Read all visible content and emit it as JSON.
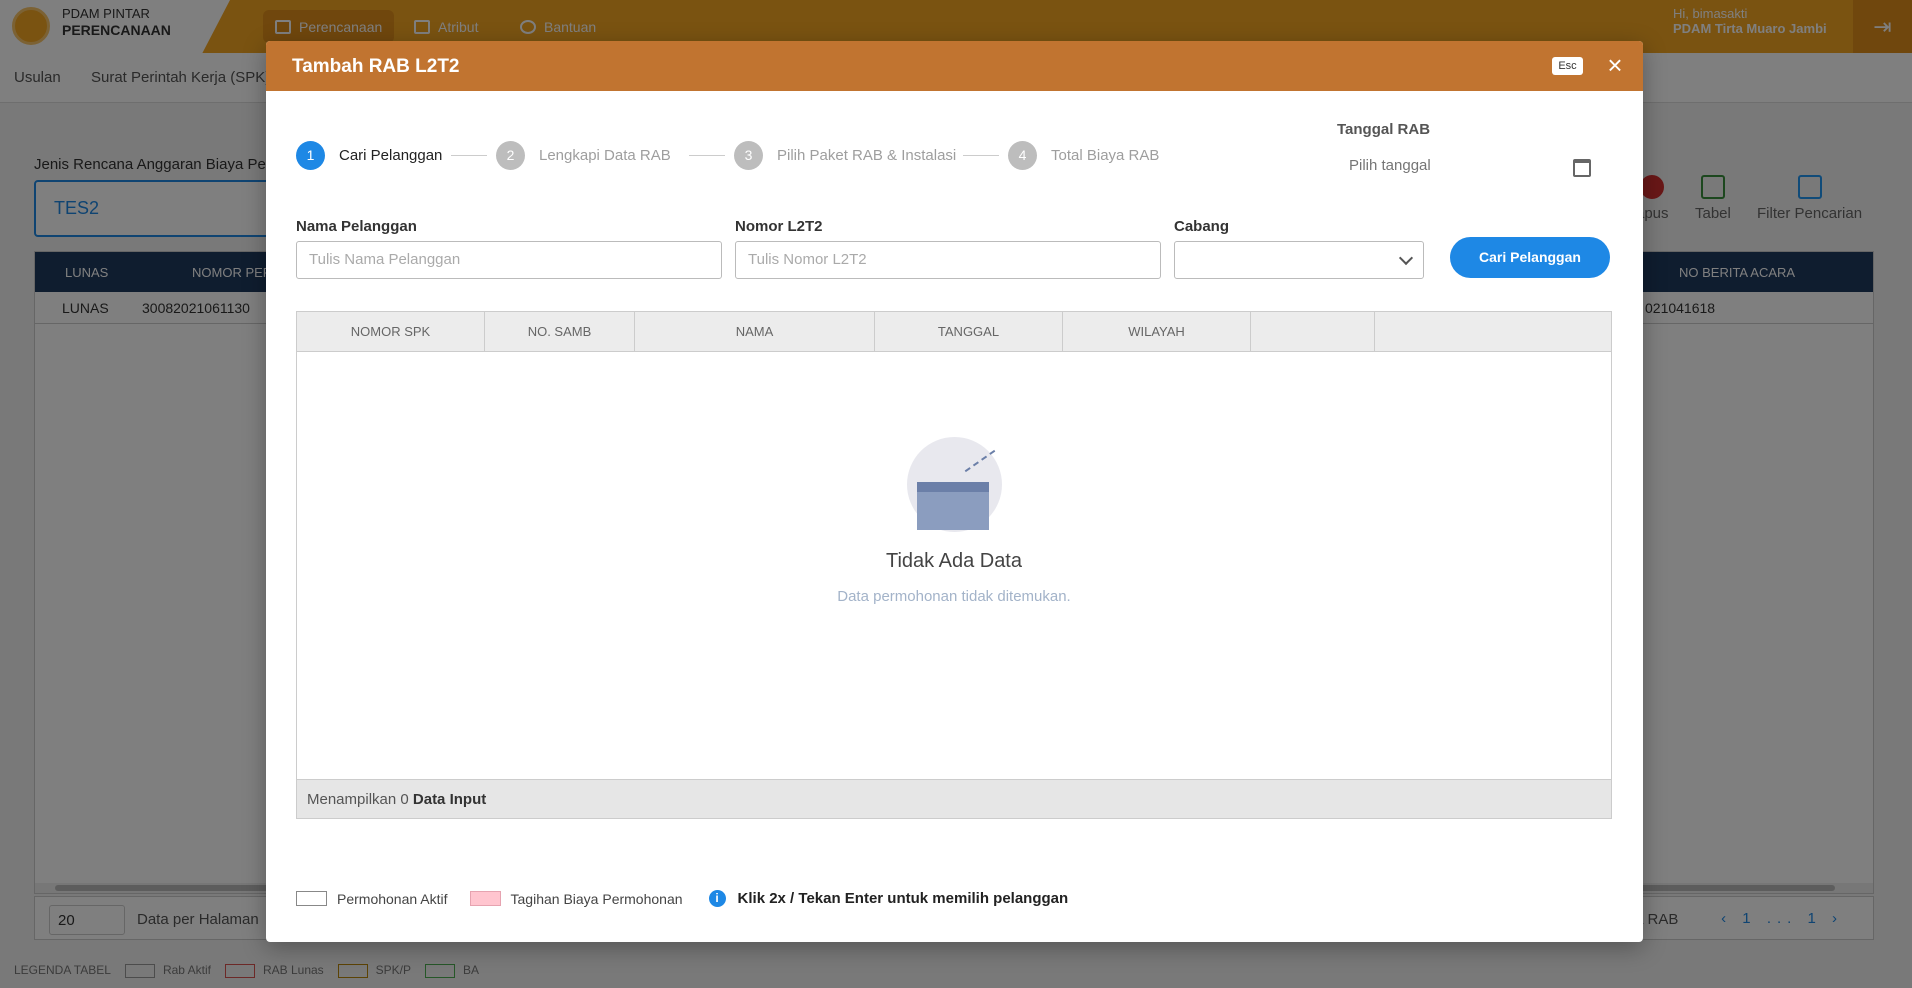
{
  "app": {
    "brand_top": "PDAM PINTAR",
    "brand_bottom": "PERENCANAAN",
    "nav": [
      {
        "label": "Perencanaan",
        "active": true
      },
      {
        "label": "Atribut"
      },
      {
        "label": "Bantuan"
      }
    ],
    "user_greeting": "Hi, bimasakti",
    "user_org": "PDAM Tirta Muaro Jambi",
    "subnav": [
      "Usulan",
      "Surat Perintah Kerja (SPK)"
    ],
    "form_label": "Jenis Rencana Anggaran Biaya Pela",
    "form_value": "TES2",
    "toolbar": [
      "apus",
      "Tabel",
      "Filter Pencarian"
    ],
    "table_headers": [
      "LUNAS",
      "NOMOR PERM",
      "NO BERITA ACARA"
    ],
    "table_row": [
      "LUNAS",
      "30082021061130",
      "021041618"
    ],
    "page_size": "20",
    "per_page_label": "Data per Halaman",
    "pager_right": "a RAB",
    "pager_pages": "‹ 1 ... 1 ›",
    "legend_title": "LEGENDA TABEL",
    "legend": [
      "Rab Aktif",
      "RAB Lunas",
      "SPK/P",
      "BA"
    ],
    "legend_colors": [
      "#cccccc",
      "#d9534f",
      "#b8860b",
      "#4caf50"
    ],
    "accent": "#f5a623"
  },
  "modal": {
    "title": "Tambah RAB L2T2",
    "esc": "Esc",
    "close": "×",
    "steps": [
      {
        "num": "1",
        "label": "Cari Pelanggan",
        "active": true
      },
      {
        "num": "2",
        "label": "Lengkapi Data RAB"
      },
      {
        "num": "3",
        "label": "Pilih Paket RAB & Instalasi"
      },
      {
        "num": "4",
        "label": "Total Biaya RAB"
      }
    ],
    "tanggal_label": "Tanggal RAB",
    "tanggal_placeholder": "Pilih tanggal",
    "fields": {
      "nama_label": "Nama Pelanggan",
      "nama_placeholder": "Tulis Nama Pelanggan",
      "nomor_label": "Nomor L2T2",
      "nomor_placeholder": "Tulis Nomor L2T2",
      "cabang_label": "Cabang",
      "cabang_value": ""
    },
    "search_button": "Cari Pelanggan",
    "columns": [
      "NOMOR SPK",
      "NO. SAMB",
      "NAMA",
      "TANGGAL",
      "WILAYAH",
      "",
      ""
    ],
    "empty_title": "Tidak Ada Data",
    "empty_sub": "Data permohonan tidak ditemukan.",
    "footer_prefix": "Menampilkan 0",
    "footer_bold": "Data Input",
    "legend": [
      "Permohonan Aktif",
      "Tagihan Biaya Permohonan"
    ],
    "hint": "Klik 2x / Tekan Enter untuk memilih pelanggan",
    "header_color": "#c17430",
    "primary_color": "#1e88e5"
  }
}
